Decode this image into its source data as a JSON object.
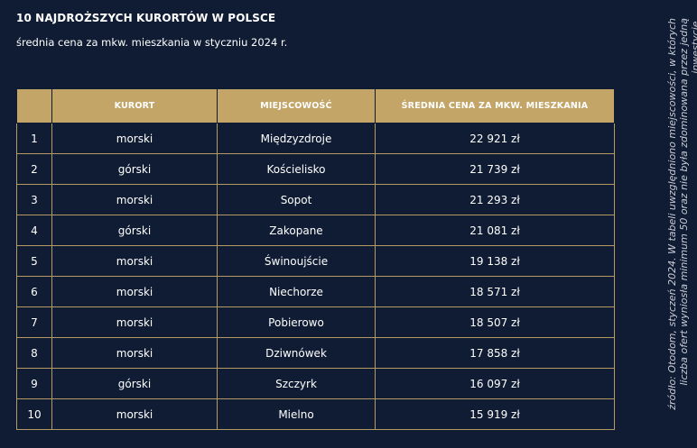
{
  "title": "10 NAJDROŻSZYCH KURORTÓW W POLSCE",
  "subtitle": "średnia cena za mkw. mieszkania w styczniu 2024 r.",
  "table": {
    "headers": [
      "",
      "KURORT",
      "MIEJSCOWOŚĆ",
      "ŚREDNIA CENA ZA MKW. MIESZKANIA"
    ],
    "rows": [
      [
        "1",
        "morski",
        "Międzyzdroje",
        "22 921 zł"
      ],
      [
        "2",
        "górski",
        "Kościelisko",
        "21 739 zł"
      ],
      [
        "3",
        "morski",
        "Sopot",
        "21 293 zł"
      ],
      [
        "4",
        "górski",
        "Zakopane",
        "21 081 zł"
      ],
      [
        "5",
        "morski",
        "Świnoujście",
        "19 138 zł"
      ],
      [
        "6",
        "morski",
        "Niechorze",
        "18 571 zł"
      ],
      [
        "7",
        "morski",
        "Pobierowo",
        "18 507 zł"
      ],
      [
        "8",
        "morski",
        "Dziwnówek",
        "17 858 zł"
      ],
      [
        "9",
        "górski",
        "Szczyrk",
        "16 097 zł"
      ],
      [
        "10",
        "morski",
        "Mielno",
        "15 919 zł"
      ]
    ]
  },
  "source_note": "źródło: Otodom, styczeń 2024. W tabeli uwzględniono miejscowości, w których liczba ofert wyniosła minimum 50 oraz nie była zdominowana przez jedną inwestycję."
}
